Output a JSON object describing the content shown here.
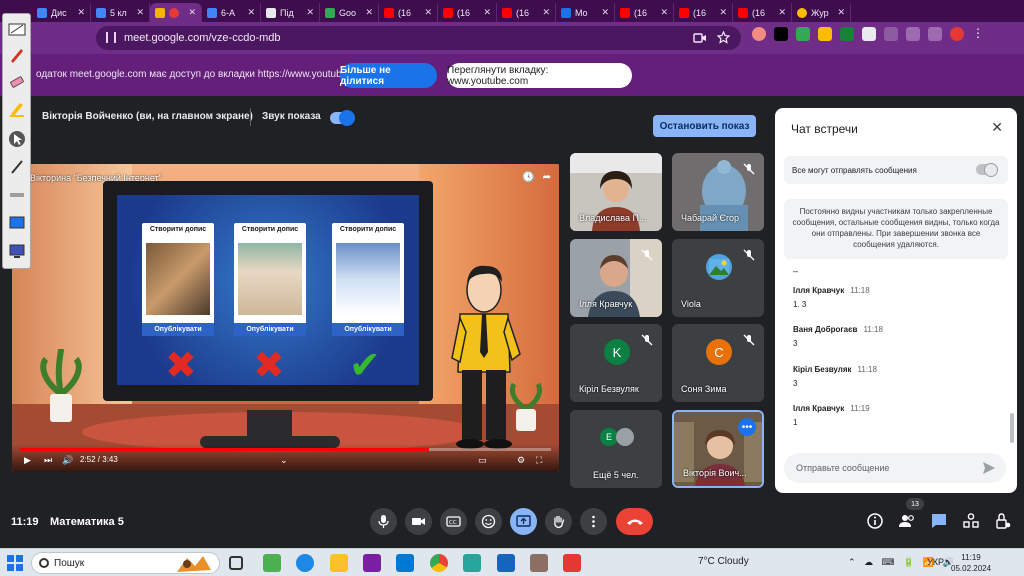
{
  "browser": {
    "tabs": [
      {
        "label": "Дис",
        "color": "#4285f4"
      },
      {
        "label": "5 кл",
        "color": "#4285f4"
      },
      {
        "label": "",
        "color": "#f4b400",
        "active": true
      },
      {
        "label": "6-А",
        "color": "#4285f4"
      },
      {
        "label": "Під",
        "color": "#e8eaed"
      },
      {
        "label": "Goo",
        "color": "#34a853"
      },
      {
        "label": "(16",
        "color": "#ff0000"
      },
      {
        "label": "(16",
        "color": "#ff0000"
      },
      {
        "label": "(16",
        "color": "#ff0000"
      },
      {
        "label": "Mo",
        "color": "#1a73e8"
      },
      {
        "label": "(16",
        "color": "#ff0000"
      },
      {
        "label": "(16",
        "color": "#ff0000"
      },
      {
        "label": "(16",
        "color": "#ff0000"
      },
      {
        "label": "Жур",
        "color": "#fbbc04"
      }
    ],
    "url": "meet.google.com/vze-ccdo-mdb"
  },
  "notice": {
    "text": "одаток meet.google.com має доступ до вкладки https://www.youtube.com",
    "stop_label": "Більше не ділитися",
    "view_label": "Переглянути вкладку: www.youtube.com"
  },
  "presentation": {
    "presenter": "Вікторія Войченко (ви, на главном экране)",
    "sound_label": "Звук показа",
    "stop_label": "Остановить показ",
    "video_title": "Вікторина \"Безпечний Інтернет\"",
    "video_time": "2:52 / 3:43",
    "video_progress": 0.77,
    "cards": [
      {
        "title": "Створити допис",
        "button": "Опублікувати",
        "mark": "✖"
      },
      {
        "title": "Створити допис",
        "button": "Опублікувати",
        "mark": "✖"
      },
      {
        "title": "Створити допис",
        "button": "Опублікувати",
        "mark": "✔"
      }
    ]
  },
  "participants": [
    {
      "name": "Владислава П...",
      "kind": "video"
    },
    {
      "name": "Чабарай Єгор",
      "kind": "video"
    },
    {
      "name": "Ілля Кравчук",
      "kind": "video"
    },
    {
      "name": "Viola",
      "kind": "image"
    },
    {
      "name": "Кіріл Безвуляк",
      "kind": "avatar",
      "initial": "K",
      "color": "#0b8043"
    },
    {
      "name": "Соня Зима",
      "kind": "avatar",
      "initial": "C",
      "color": "#e8710a"
    },
    {
      "name": "Ещё 5 чел.",
      "kind": "more",
      "initial": "E"
    },
    {
      "name": "Вікторія Воич...",
      "kind": "self"
    }
  ],
  "chat": {
    "title": "Чат встречи",
    "allow_label": "Все могут отправлять сообщения",
    "info": "Постоянно видны участникам только закрепленные сообщения, остальные сообщения видны, только когда они отправлены. При завершении звонка все сообщения удаляются.",
    "dash": "–",
    "messages": [
      {
        "author": "Ілля Кравчук",
        "time": "11:18",
        "text": "1. 3"
      },
      {
        "author": "Ваня Доброгаєв",
        "time": "11:18",
        "text": "3"
      },
      {
        "author": "Кіріл Безвуляк",
        "time": "11:18",
        "text": "3"
      },
      {
        "author": "Ілля Кравчук",
        "time": "11:19",
        "text": "1"
      }
    ],
    "placeholder": "Отправьте сообщение"
  },
  "controls": {
    "clock": "11:19",
    "meeting_name": "Математика 5",
    "people_count": "13"
  },
  "taskbar": {
    "search_label": "Пошук",
    "weather": "7°C  Cloudy",
    "lang": "УКР",
    "time": "11:19",
    "date": "05.02.2024"
  }
}
